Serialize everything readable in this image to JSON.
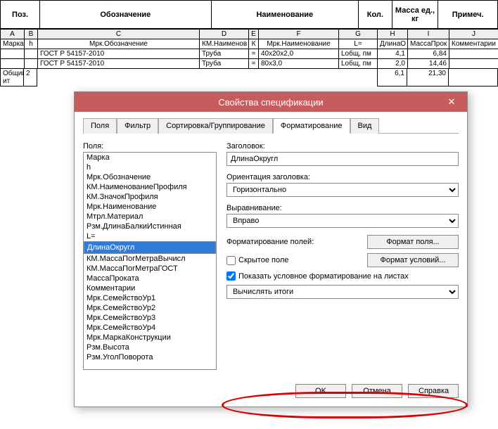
{
  "sheet": {
    "header_cols": [
      "Поз.",
      "Обозначение",
      "Наименование",
      "Кол.",
      "Масса ед., кг",
      "Примеч."
    ],
    "col_letters": [
      "A",
      "B",
      "C",
      "D",
      "E",
      "F",
      "G",
      "H",
      "I",
      "J"
    ],
    "secondary_headers": [
      "Марка",
      "h",
      "Мрк.Обозначение",
      "КМ.Наименов",
      "К",
      "Мрк.Наименование",
      "L=",
      "ДлинаО",
      "МассаПрок",
      "Комментарии"
    ],
    "rows": [
      {
        "c": "ГОСТ Р 54157-2010",
        "d": "Труба",
        "e": "=",
        "f": "40x20x2,0",
        "g": "Lобщ, пм",
        "h": "4,1",
        "i": "6,84"
      },
      {
        "c": "ГОСТ Р 54157-2010",
        "d": "Труба",
        "e": "=",
        "f": "80x3,0",
        "g": "Lобщ, пм",
        "h": "2,0",
        "i": "14,46"
      }
    ],
    "totals_label": "Общий ит",
    "totals_b": "2",
    "totals_h": "6,1",
    "totals_i": "21,30"
  },
  "dialog": {
    "title": "Свойства спецификации",
    "tabs": [
      "Поля",
      "Фильтр",
      "Сортировка/Группирование",
      "Форматирование",
      "Вид"
    ],
    "active_tab": 3,
    "fields_label": "Поля:",
    "fields_list": [
      "Марка",
      "h",
      "Мрк.Обозначение",
      "КМ.НаименованиеПрофиля",
      "КМ.ЗначокПрофиля",
      "Мрк.Наименование",
      "Мтрл.Материал",
      "Рзм.ДлинаБалкиИстинная",
      "L=",
      "ДлинаОкругл",
      "КМ.МассаПогМетраВычисл",
      "КМ.МассаПогМетраГОСТ",
      "МассаПроката",
      "Комментарии",
      "Мрк.СемействоУр1",
      "Мрк.СемействоУр2",
      "Мрк.СемействоУр3",
      "Мрк.СемействоУр4",
      "Мрк.МаркаКонструкции",
      "Рзм.Высота",
      "Рзм.УголПоворота"
    ],
    "selected_field_index": 9,
    "heading_label": "Заголовок:",
    "heading_value": "ДлинаОкругл",
    "orient_label": "Ориентация заголовка:",
    "orient_value": "Горизонтально",
    "align_label": "Выравнивание:",
    "align_value": "Вправо",
    "format_fields_label": "Форматирование полей:",
    "hidden_label": "Скрытое поле",
    "show_conditional_label": "Показать условное форматирование на листах",
    "btn_field_format": "Формат поля...",
    "btn_cond_format": "Формат условий...",
    "calc_totals_value": "Вычислять итоги",
    "btn_ok": "OK",
    "btn_cancel": "Отмена",
    "btn_help": "Справка"
  }
}
